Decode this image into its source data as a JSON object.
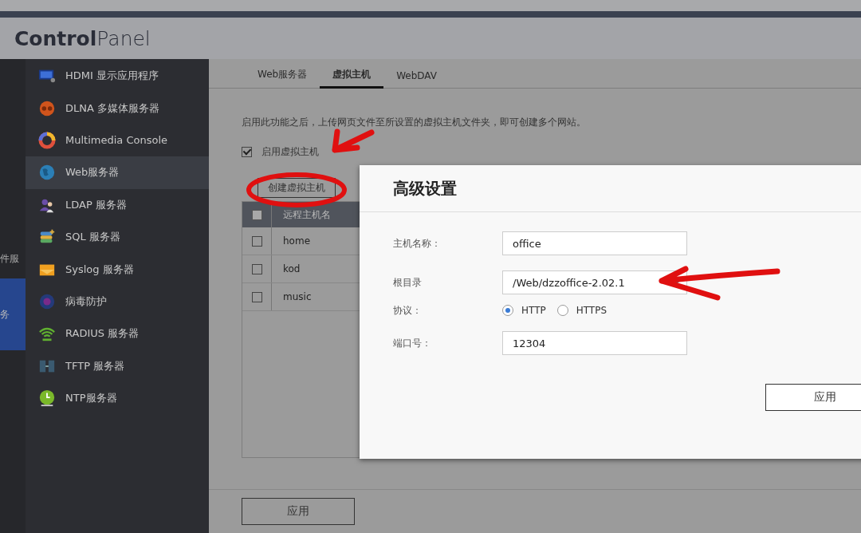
{
  "header": {
    "title": "**Control**Panel"
  },
  "left_rail": {
    "items": [
      {
        "label": "件服",
        "selected": false
      },
      {
        "label": "务",
        "selected": true
      }
    ]
  },
  "sidebar": {
    "items": [
      {
        "label": "HDMI 显示应用程序",
        "kind": "monitor",
        "selected": false
      },
      {
        "label": "DLNA 多媒体服务器",
        "kind": "media",
        "selected": false
      },
      {
        "label": "Multimedia Console",
        "kind": "ring",
        "selected": false
      },
      {
        "label": "Web服务器",
        "kind": "globe",
        "selected": true
      },
      {
        "label": "LDAP 服务器",
        "kind": "users",
        "selected": false
      },
      {
        "label": "SQL 服务器",
        "kind": "database",
        "selected": false
      },
      {
        "label": "Syslog 服务器",
        "kind": "mail",
        "selected": false
      },
      {
        "label": "病毒防护",
        "kind": "virus",
        "selected": false
      },
      {
        "label": "RADIUS 服务器",
        "kind": "wifi",
        "selected": false
      },
      {
        "label": "TFTP 服务器",
        "kind": "server",
        "selected": false
      },
      {
        "label": "NTP服务器",
        "kind": "clock",
        "selected": false
      }
    ]
  },
  "tabs": [
    {
      "label": "Web服务器",
      "selected": false
    },
    {
      "label": "虚拟主机",
      "selected": true
    },
    {
      "label": "WebDAV",
      "selected": false
    }
  ],
  "description": "启用此功能之后，上传网页文件至所设置的虚拟主机文件夹，即可创建多个网站。",
  "enable_checkbox": {
    "label": "启用虚拟主机",
    "checked": true
  },
  "create_button": "创建虚拟主机",
  "table": {
    "columns": [
      "远程主机名"
    ],
    "header_checked": false,
    "rows": [
      {
        "name": "home",
        "checked": false
      },
      {
        "name": "kod",
        "checked": false
      },
      {
        "name": "music",
        "checked": false
      }
    ]
  },
  "apply_button": "应用",
  "dialog": {
    "title": "高级设置",
    "fields": [
      {
        "kind": "text",
        "label": "主机名称：",
        "value": "office"
      },
      {
        "kind": "select",
        "label": "根目录",
        "value": "/Web/dzzoffice-2.02.1"
      },
      {
        "kind": "radio",
        "label": "协议：",
        "options": [
          {
            "label": "HTTP",
            "selected": true
          },
          {
            "label": "HTTPS",
            "selected": false
          }
        ]
      },
      {
        "kind": "text",
        "label": "端口号：",
        "value": "12304"
      }
    ],
    "apply_button": "应用"
  }
}
